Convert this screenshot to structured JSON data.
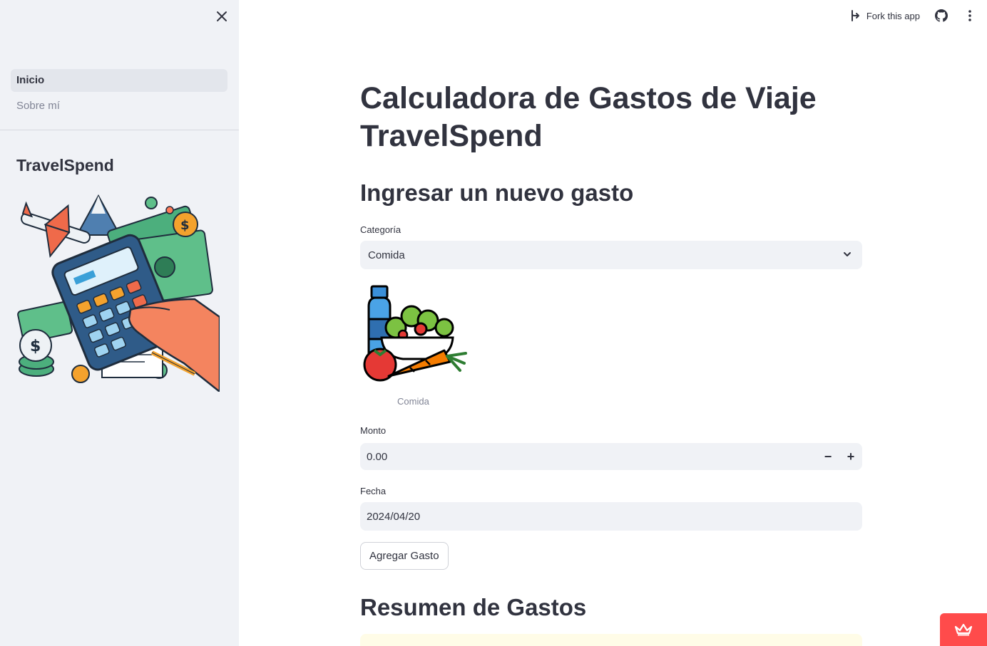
{
  "sidebar": {
    "nav": [
      {
        "label": "Inicio",
        "active": true
      },
      {
        "label": "Sobre mí",
        "active": false
      }
    ],
    "title": "TravelSpend",
    "close_icon": "close-icon",
    "illustration": "travel-expense-illustration"
  },
  "toolbar": {
    "fork_label": "Fork this app",
    "fork_icon": "fork-icon",
    "github_icon": "github-icon",
    "menu_icon": "more-vertical-icon"
  },
  "main": {
    "title": "Calculadora de Gastos de Viaje TravelSpend",
    "new_expense_heading": "Ingresar un nuevo gasto",
    "category": {
      "label": "Categoría",
      "value": "Comida"
    },
    "image_caption": "Comida",
    "amount": {
      "label": "Monto",
      "value": "0.00",
      "minus": "−",
      "plus": "+"
    },
    "date": {
      "label": "Fecha",
      "value": "2024/04/20"
    },
    "add_button": "Agregar Gasto",
    "summary_heading": "Resumen de Gastos"
  },
  "colors": {
    "sidebar_bg": "#f0f2f6",
    "input_bg": "#f0f2f6",
    "text": "#31333f",
    "accent": "#ff4b4b",
    "info_bg": "#fffce7"
  }
}
